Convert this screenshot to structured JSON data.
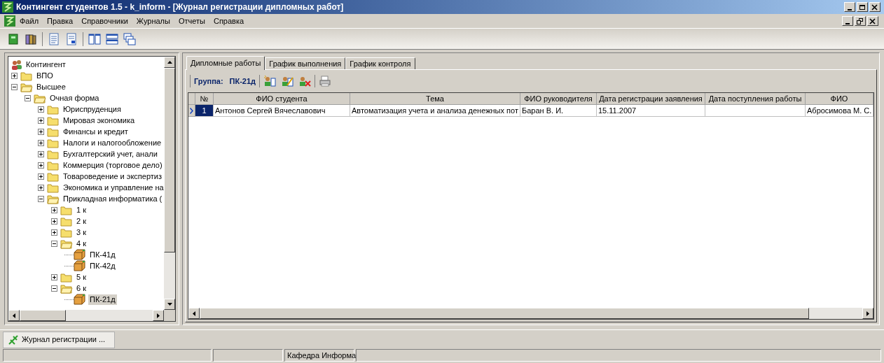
{
  "window": {
    "title": "Контингент студентов 1.5 - k_inform - [Журнал регистрации дипломных работ]"
  },
  "menu": [
    "Файл",
    "Правка",
    "Справочники",
    "Журналы",
    "Отчеты",
    "Справка"
  ],
  "tree": [
    {
      "label": "Контингент",
      "kind": "root",
      "selected": false,
      "children": [
        {
          "label": "ВПО",
          "kind": "folder",
          "expanded": false,
          "selected": false
        },
        {
          "label": "Высшее",
          "kind": "folder",
          "expanded": true,
          "selected": false,
          "children": [
            {
              "label": "Очная форма",
              "kind": "folder",
              "expanded": true,
              "selected": false,
              "children": [
                {
                  "label": "Юриспруденция",
                  "kind": "folder",
                  "expanded": false,
                  "selected": false
                },
                {
                  "label": "Мировая экономика",
                  "kind": "folder",
                  "expanded": false,
                  "selected": false
                },
                {
                  "label": "Финансы и кредит",
                  "kind": "folder",
                  "expanded": false,
                  "selected": false
                },
                {
                  "label": "Налоги и налогообложение",
                  "kind": "folder",
                  "expanded": false,
                  "selected": false
                },
                {
                  "label": "Бухгалтерский учет, анали",
                  "kind": "folder",
                  "expanded": false,
                  "selected": false
                },
                {
                  "label": "Коммерция (торговое дело)",
                  "kind": "folder",
                  "expanded": false,
                  "selected": false
                },
                {
                  "label": "Товароведение и экспертиз",
                  "kind": "folder",
                  "expanded": false,
                  "selected": false
                },
                {
                  "label": "Экономика и управление на",
                  "kind": "folder",
                  "expanded": false,
                  "selected": false
                },
                {
                  "label": "Прикладная информатика (",
                  "kind": "folder",
                  "expanded": true,
                  "selected": false,
                  "children": [
                    {
                      "label": "1 к",
                      "kind": "folder",
                      "expanded": false,
                      "selected": false
                    },
                    {
                      "label": "2 к",
                      "kind": "folder",
                      "expanded": false,
                      "selected": false
                    },
                    {
                      "label": "3 к",
                      "kind": "folder",
                      "expanded": false,
                      "selected": false
                    },
                    {
                      "label": "4 к",
                      "kind": "folder",
                      "expanded": true,
                      "selected": false,
                      "children": [
                        {
                          "label": "ПК-41д",
                          "kind": "group",
                          "selected": false
                        },
                        {
                          "label": "ПК-42д",
                          "kind": "group",
                          "selected": false
                        }
                      ]
                    },
                    {
                      "label": "5 к",
                      "kind": "folder",
                      "expanded": false,
                      "selected": false
                    },
                    {
                      "label": "6 к",
                      "kind": "folder",
                      "expanded": true,
                      "selected": false,
                      "children": [
                        {
                          "label": "ПК-21д",
                          "kind": "group",
                          "selected": true
                        }
                      ]
                    }
                  ]
                }
              ]
            }
          ]
        }
      ]
    }
  ],
  "tabs": [
    {
      "label": "Дипломные работы",
      "selected": true
    },
    {
      "label": "График выполнения",
      "selected": false
    },
    {
      "label": "График контроля",
      "selected": false
    }
  ],
  "group_label": "Группа:",
  "group_value": "ПК-21д",
  "table": {
    "columns": [
      "№",
      "ФИО студента",
      "Тема",
      "ФИО руководителя",
      "Дата регистрации заявления",
      "Дата поступления работы",
      "ФИО"
    ],
    "rows": [
      {
        "selected": true,
        "cells": [
          "1",
          "Антонов Сергей Вячеславович",
          "Автоматизация учета и анализа денежных пот",
          "Баран  В. И.",
          "15.11.2007",
          "",
          "Абросимова  М. С."
        ]
      }
    ]
  },
  "taskbar": [
    {
      "label": "Журнал регистрации ...",
      "selected": true
    }
  ],
  "status_bar": {
    "department": "Кафедра Информа"
  }
}
